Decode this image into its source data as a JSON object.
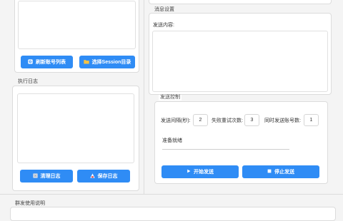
{
  "left_top": {
    "refresh_button": "刷新账号列表",
    "select_session_button": "选择Session目录"
  },
  "log_section": {
    "title": "执行日志",
    "clear_button": "清理日志",
    "save_button": "保存日志"
  },
  "message_section": {
    "title": "消息设置",
    "content_label": "发送内容:"
  },
  "send_control": {
    "title": "发送控制",
    "interval_label": "发送间隔(秒):",
    "interval_value": "2",
    "retry_label": "失败重试次数:",
    "retry_value": "3",
    "concurrent_label": "同时发送账号数:",
    "concurrent_value": "1",
    "status_text": "准备就绪",
    "start_button": "开始发送",
    "stop_button": "停止发送"
  },
  "instructions": {
    "title": "群发使用说明"
  },
  "colors": {
    "accent": "#2f8cf5",
    "border": "#dcdcdc"
  }
}
